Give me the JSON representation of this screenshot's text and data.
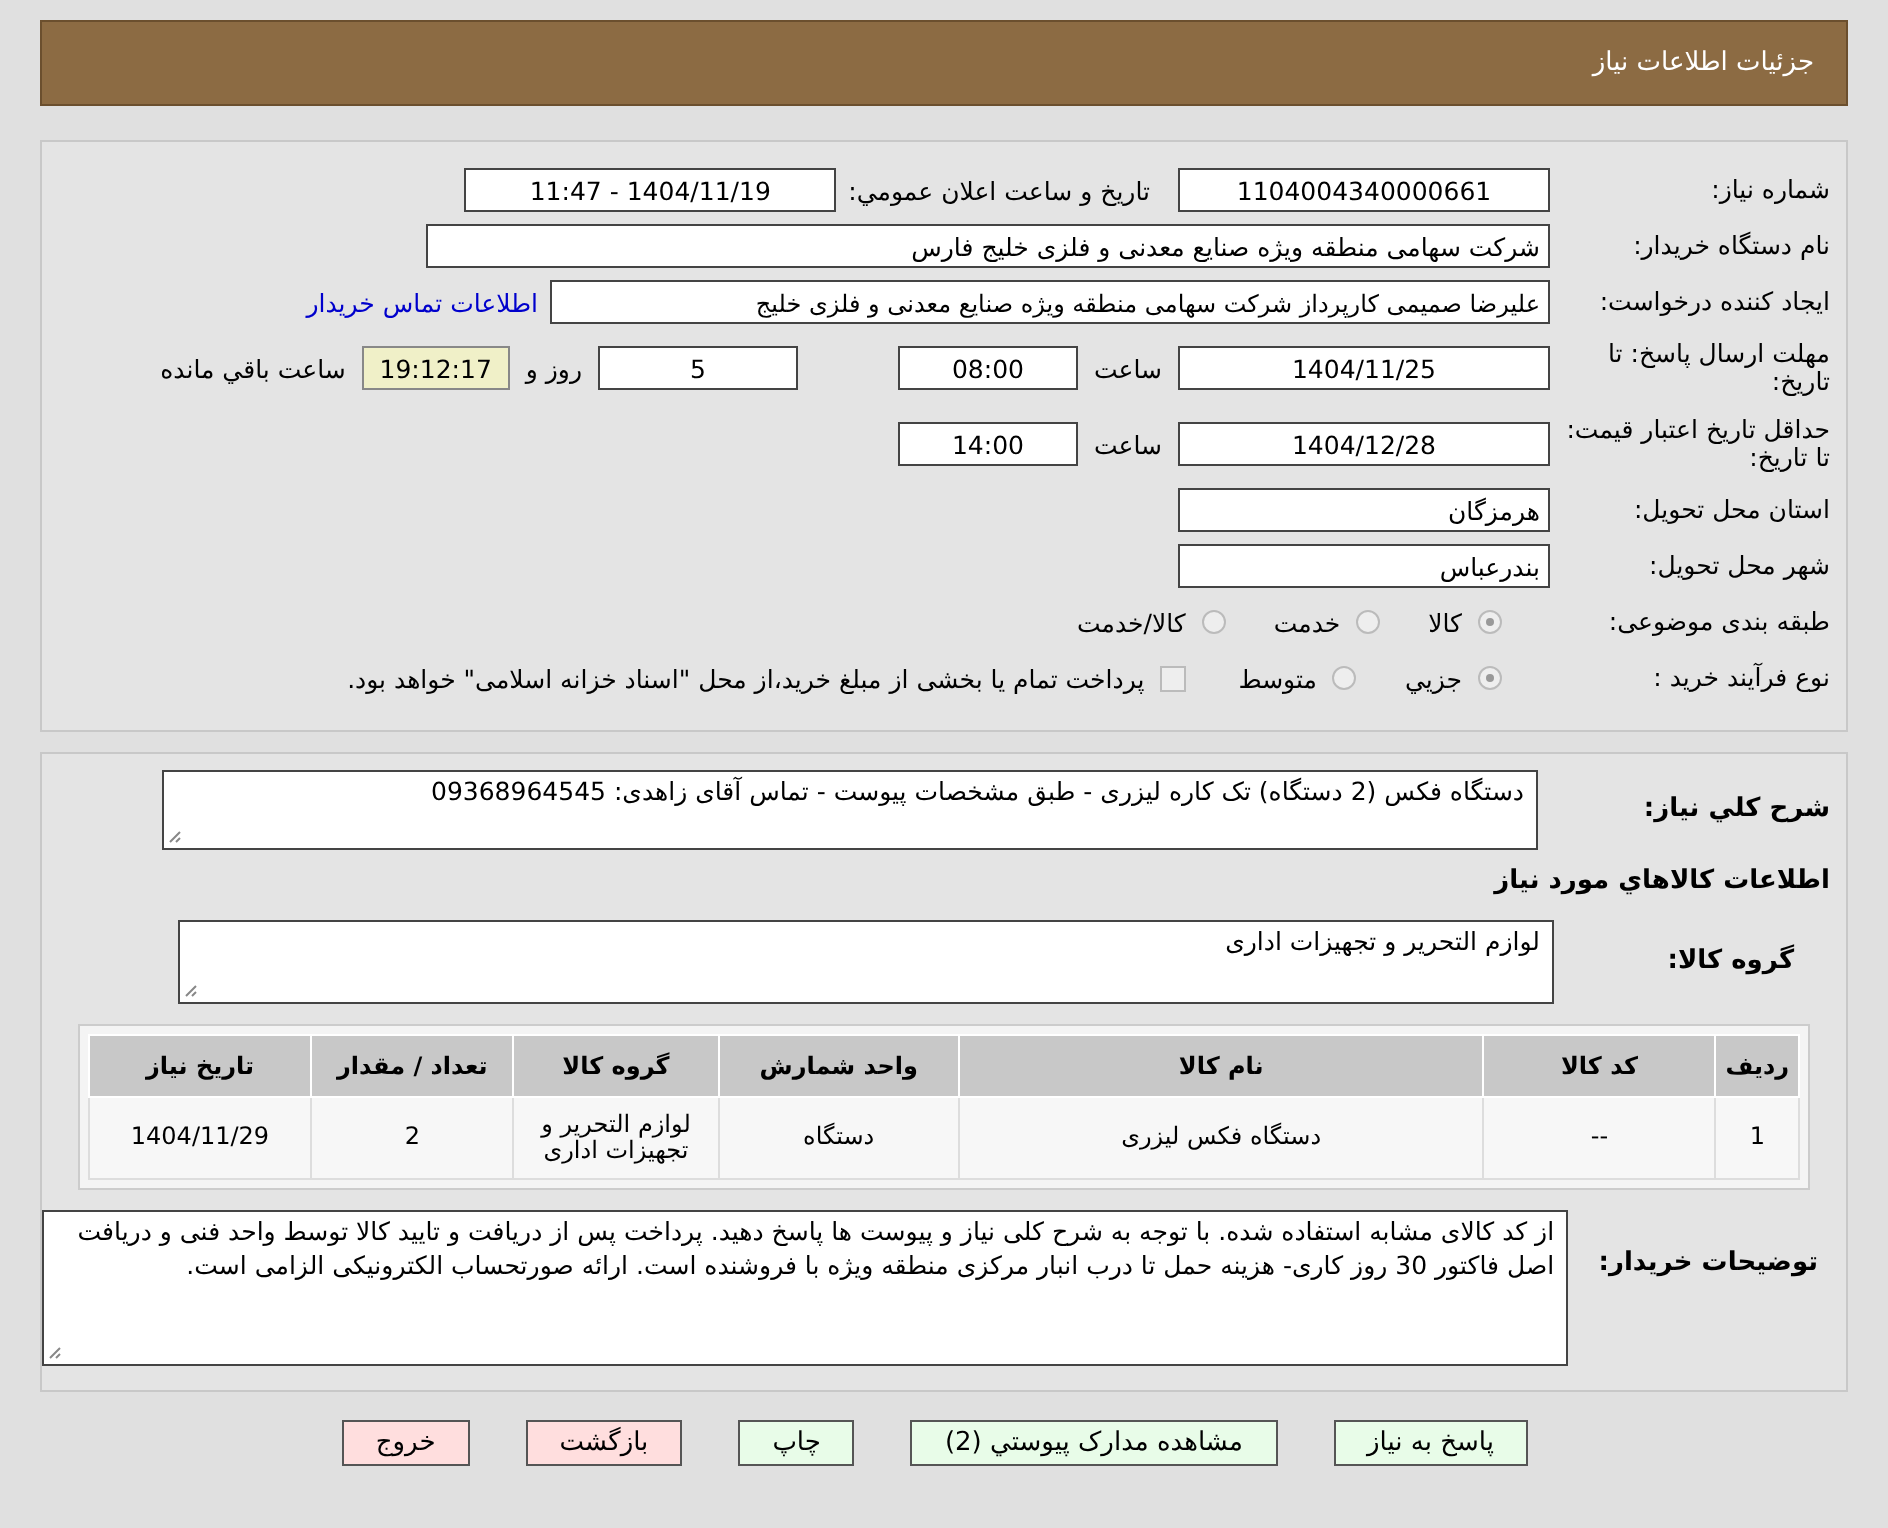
{
  "header": {
    "title": "جزئیات اطلاعات نیاز"
  },
  "need_number": {
    "label": "شماره نیاز:",
    "value": "1104004340000661"
  },
  "announce": {
    "label": "تاریخ و ساعت اعلان عمومي:",
    "value": "1404/11/19 - 11:47"
  },
  "buyer": {
    "label": "نام دستگاه خریدار:",
    "value": "شرکت سهامی منطقه ویژه صنایع معدنی و فلزی خلیج فارس"
  },
  "requester": {
    "label": "ایجاد کننده درخواست:",
    "value": "علیرضا صمیمی کارپرداز شرکت سهامی منطقه ویژه صنایع معدنی و فلزی خلیج",
    "link": "اطلاعات تماس خریدار"
  },
  "deadline": {
    "label": "مهلت ارسال پاسخ: تا تاریخ:",
    "date": "1404/11/25",
    "time_label": "ساعت",
    "time": "08:00",
    "days": "5",
    "days_label": "روز و",
    "remaining": "19:12:17",
    "remaining_label": "ساعت باقي مانده"
  },
  "validity": {
    "label": "حداقل تاریخ اعتبار قیمت: تا تاریخ:",
    "date": "1404/12/28",
    "time_label": "ساعت",
    "time": "14:00"
  },
  "province": {
    "label": "استان محل تحویل:",
    "value": "هرمزگان"
  },
  "city": {
    "label": "شهر محل تحویل:",
    "value": "بندرعباس"
  },
  "category": {
    "label": "طبقه بندی موضوعی:",
    "options": [
      {
        "label": "کالا",
        "selected": true
      },
      {
        "label": "خدمت",
        "selected": false
      },
      {
        "label": "کالا/خدمت",
        "selected": false
      }
    ]
  },
  "process": {
    "label": "نوع فرآیند خرید :",
    "options": [
      {
        "label": "جزيي",
        "selected": true
      },
      {
        "label": "متوسط",
        "selected": false
      }
    ],
    "payment": {
      "checked": false,
      "label": "پرداخت تمام یا بخشی از مبلغ خرید،از محل \"اسناد خزانه اسلامی\" خواهد بود."
    }
  },
  "description": {
    "label": "شرح کلي نياز:",
    "value": "دستگاه فکس (2 دستگاه) تک کاره لیزری - طبق مشخصات پیوست - تماس آقای زاهدی: 09368964545"
  },
  "goods_title": "اطلاعات کالاهاي مورد نياز",
  "goods_group": {
    "label": "گروه کالا:",
    "value": "لوازم التحریر و تجهیزات اداری"
  },
  "table": {
    "columns": [
      "ردیف",
      "کد کالا",
      "نام کالا",
      "واحد شمارش",
      "گروه کالا",
      "تعداد / مقدار",
      "تاریخ نیاز"
    ],
    "rows": [
      [
        "1",
        "--",
        "دستگاه فکس لیزری",
        "دستگاه",
        "لوازم التحریر و تجهیزات اداری",
        "2",
        "1404/11/29"
      ]
    ]
  },
  "notes": {
    "label": "توضیحات خریدار:",
    "value": "از کد کالای مشابه استفاده شده. با توجه به شرح کلی نیاز و پیوست ها پاسخ دهید. پرداخت پس از دریافت و تایید کالا توسط واحد فنی و دریافت اصل فاکتور 30 روز کاری- هزینه حمل تا درب انبار مرکزی منطقه ویژه با فروشنده است. ارائه صورتحساب الکترونیکی الزامی است."
  },
  "buttons": [
    {
      "label": "پاسخ به نياز",
      "kind": "green"
    },
    {
      "label": "مشاهده مدارک پيوستي (2)",
      "kind": "green"
    },
    {
      "label": "چاپ",
      "kind": "green"
    },
    {
      "label": "بازگشت",
      "kind": "red"
    },
    {
      "label": "خروج",
      "kind": "red"
    }
  ]
}
